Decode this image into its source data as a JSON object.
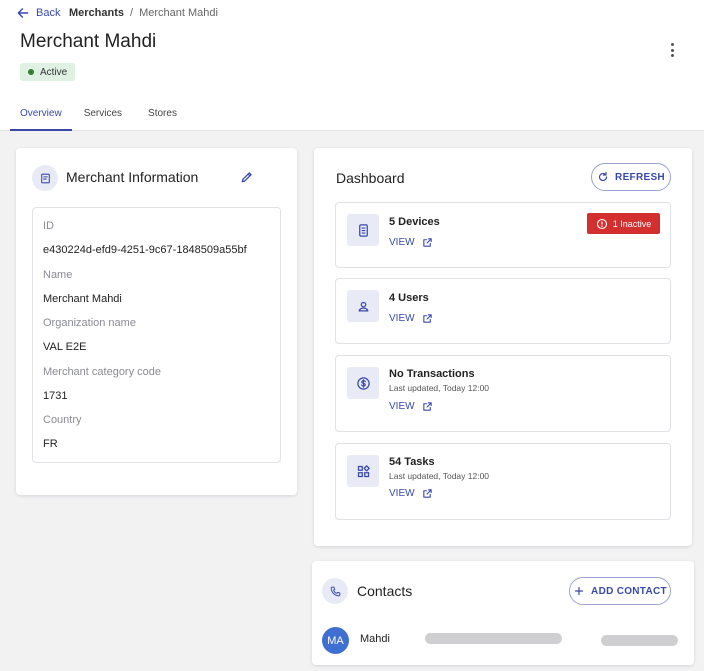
{
  "header": {
    "back_label": "Back",
    "breadcrumbs": [
      "Merchants",
      "/",
      "Merchant Mahdi"
    ],
    "title": "Merchant Mahdi",
    "status": "Active"
  },
  "tabs": [
    {
      "label": "Overview",
      "active": true
    },
    {
      "label": "Services",
      "active": false
    },
    {
      "label": "Stores",
      "active": false
    }
  ],
  "merchant_info": {
    "title": "Merchant Information",
    "fields": [
      {
        "label": "ID",
        "value": "e430224d-efd9-4251-9c67-1848509a55bf"
      },
      {
        "label": "Name",
        "value": "Merchant Mahdi"
      },
      {
        "label": "Organization name",
        "value": "VAL E2E"
      },
      {
        "label": "Merchant category code",
        "value": "1731"
      },
      {
        "label": "Country",
        "value": "FR"
      }
    ]
  },
  "dashboard": {
    "title": "Dashboard",
    "refresh_label": "REFRESH",
    "items": [
      {
        "name": "5 Devices",
        "sub": "",
        "view": "VIEW",
        "badge": "1 Inactive",
        "icon": "device-icon"
      },
      {
        "name": "4 Users",
        "sub": "",
        "view": "VIEW",
        "badge": "",
        "icon": "user-icon"
      },
      {
        "name": "No Transactions",
        "sub": "Last updated, Today 12:00",
        "view": "VIEW",
        "badge": "",
        "icon": "dollar-icon"
      },
      {
        "name": "54 Tasks",
        "sub": "Last updated, Today 12:00",
        "view": "VIEW",
        "badge": "",
        "icon": "tasks-icon"
      }
    ]
  },
  "contacts": {
    "title": "Contacts",
    "add_label": "ADD CONTACT",
    "list": [
      {
        "initials": "MA",
        "name": "Mahdi"
      }
    ]
  },
  "colors": {
    "accent": "#3949ab",
    "active_badge_bg": "#dff1e2",
    "active_dot": "#2e7d32",
    "inactive_badge": "#d32f2f",
    "avatar": "#3f6fd1"
  }
}
